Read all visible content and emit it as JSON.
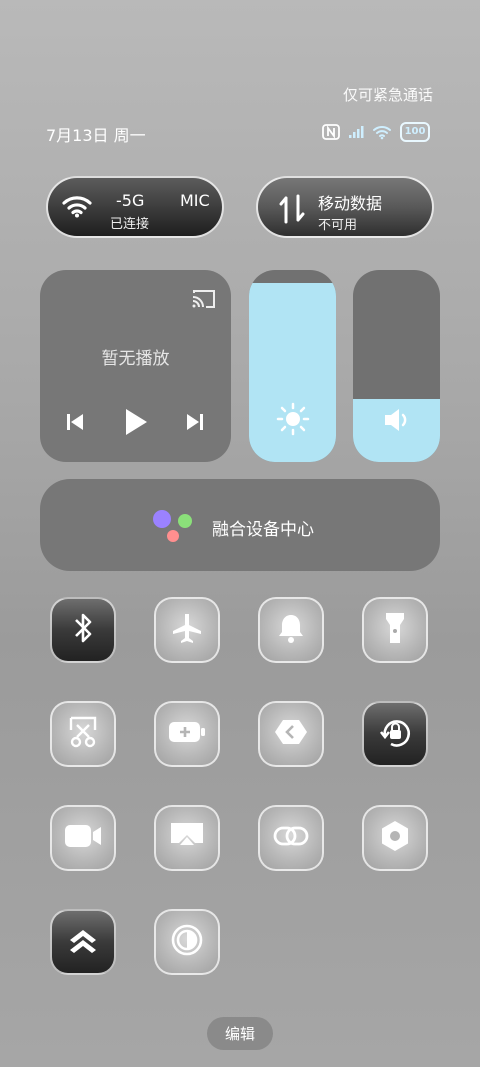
{
  "status_bar": {
    "emergency_text": "仅可紧急通话",
    "date_text": "7月13日 周一",
    "battery_level": "100",
    "icons": [
      "nfc-icon",
      "signal-icon",
      "wifi-icon",
      "battery-icon"
    ]
  },
  "wifi_pill": {
    "title": "-5G",
    "title_extra": "MIC",
    "subtitle": "已连接"
  },
  "data_pill": {
    "title": "移动数据",
    "subtitle": "不可用"
  },
  "media": {
    "label": "暂无播放",
    "icons": [
      "cast-icon",
      "previous-icon",
      "play-icon",
      "next-icon"
    ]
  },
  "brightness": {
    "level": 0.93
  },
  "volume": {
    "level": 0.33
  },
  "device_center": {
    "label": "融合设备中心",
    "colors": [
      "#9b82ff",
      "#8be07a",
      "#ff8f8f"
    ]
  },
  "toggles": [
    "bluetooth-icon",
    "airplane-icon",
    "bell-icon",
    "flashlight-icon",
    "screenshot-icon",
    "battery-saver-icon",
    "link-share-icon",
    "rotation-lock-icon",
    "video-icon",
    "cast-screen-icon",
    "connect-icon",
    "settings-icon",
    "layers-icon",
    "contrast-icon"
  ],
  "edit_label": "编辑"
}
